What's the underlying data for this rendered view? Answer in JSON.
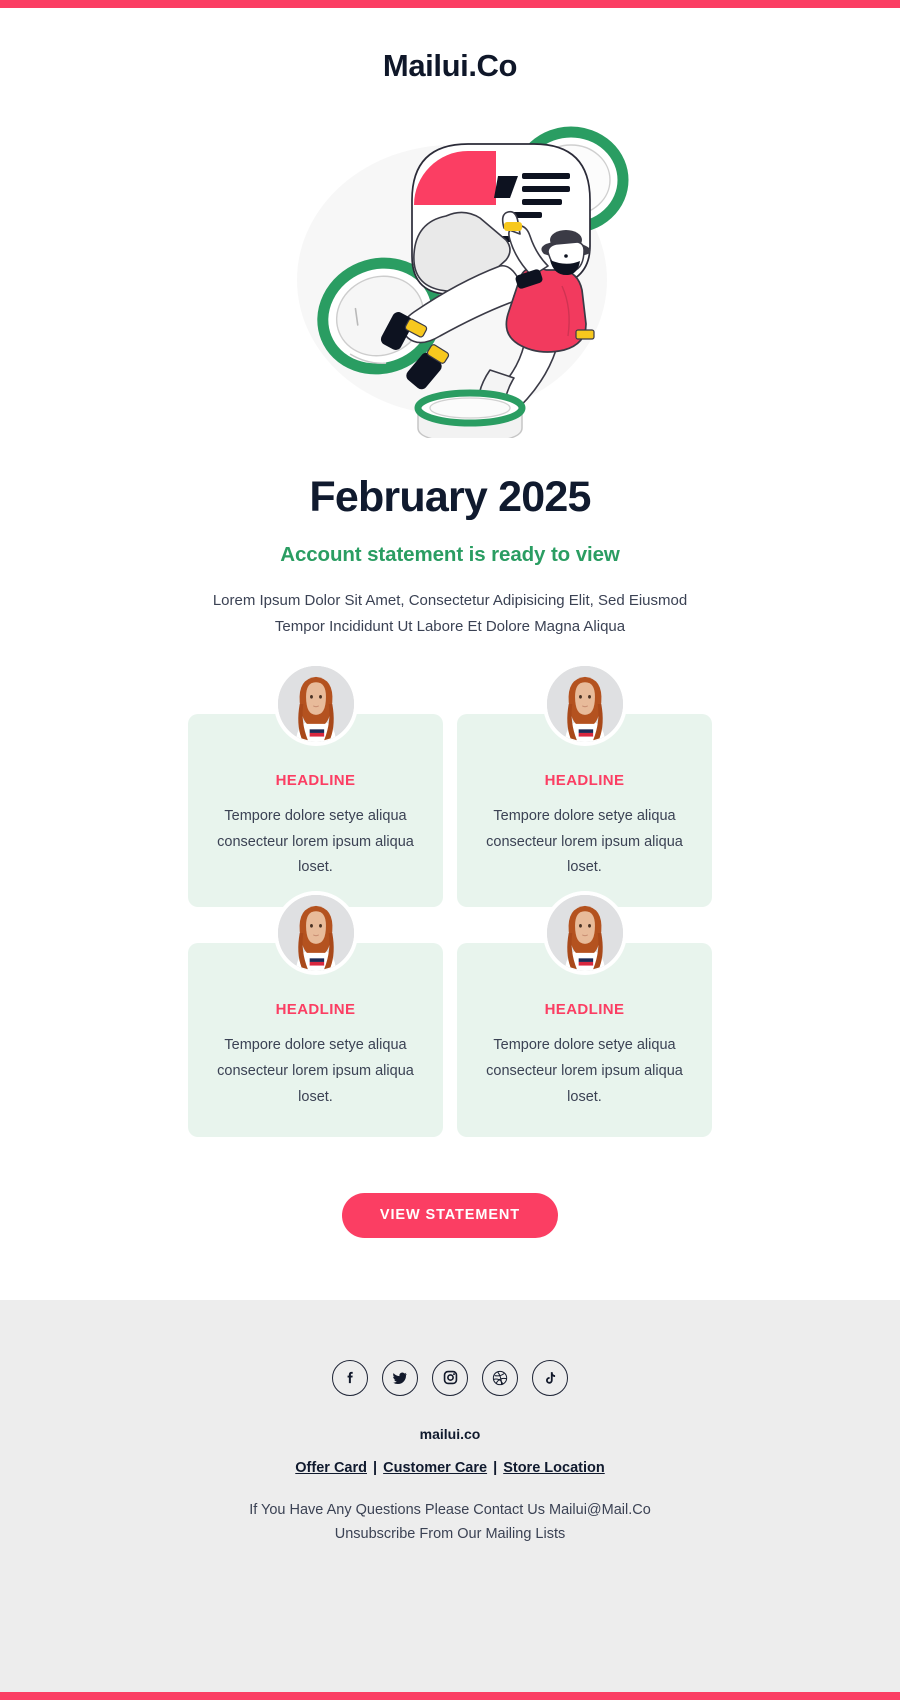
{
  "theme": {
    "accent_pink": "#fb3e63",
    "green": "#2a9d62",
    "dark_navy": "#101a2e",
    "card_bg": "#e8f4ed",
    "footer_bg": "#ededed",
    "body_text": "#3b4254"
  },
  "brand": {
    "name": "Mailui.Co"
  },
  "hero": {
    "illustration_name": "acrobat-balancing-rings-illustration"
  },
  "headline": {
    "month": "February 2025",
    "subtitle": "Account statement is ready to view",
    "lede": "Lorem Ipsum Dolor Sit Amet, Consectetur Adipisicing Elit, Sed Eiusmod Tempor Incididunt Ut Labore Et Dolore Magna Aliqua"
  },
  "cards": [
    {
      "headline": "HEADLINE",
      "text": "Tempore dolore setye aliqua consecteur lorem ipsum aliqua loset.",
      "avatar_name": "woman-portrait-avatar"
    },
    {
      "headline": "HEADLINE",
      "text": "Tempore dolore setye aliqua consecteur lorem ipsum aliqua loset.",
      "avatar_name": "woman-portrait-avatar"
    },
    {
      "headline": "HEADLINE",
      "text": "Tempore dolore setye aliqua consecteur lorem ipsum aliqua loset.",
      "avatar_name": "woman-portrait-avatar"
    },
    {
      "headline": "HEADLINE",
      "text": "Tempore dolore setye aliqua consecteur lorem ipsum aliqua loset.",
      "avatar_name": "woman-portrait-avatar"
    }
  ],
  "cta": {
    "label": "VIEW STATEMENT"
  },
  "footer": {
    "social": [
      {
        "name": "facebook-icon",
        "label": "Facebook"
      },
      {
        "name": "twitter-icon",
        "label": "Twitter"
      },
      {
        "name": "instagram-icon",
        "label": "Instagram"
      },
      {
        "name": "dribbble-icon",
        "label": "Dribbble"
      },
      {
        "name": "tiktok-icon",
        "label": "TikTok"
      }
    ],
    "site": "mailui.co",
    "links": [
      {
        "label": "Offer Card"
      },
      {
        "label": "Customer Care"
      },
      {
        "label": "Store Location"
      }
    ],
    "separator": "|",
    "note_line_1": "If You Have Any Questions Please Contact Us Mailui@Mail.Co",
    "note_line_2": "Unsubscribe From Our Mailing Lists"
  }
}
